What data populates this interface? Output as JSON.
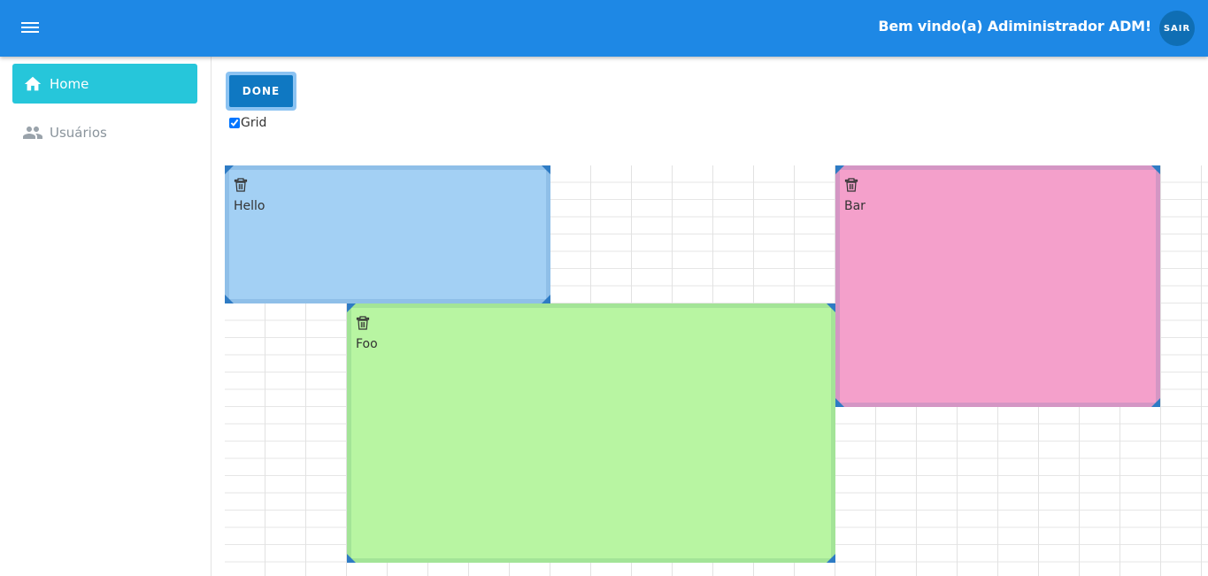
{
  "header": {
    "welcome_text": "Bem vindo(a) Adiministrador ADM!",
    "logout_label": "SAIR",
    "menu_icon": "hamburger-menu-icon",
    "background_color": "#1e88e5"
  },
  "sidebar": {
    "items": [
      {
        "label": "Home",
        "icon": "home-icon",
        "active": true
      },
      {
        "label": "Usuários",
        "icon": "people-icon",
        "active": false
      }
    ],
    "active_color": "#26c6da"
  },
  "toolbar": {
    "done_label": "DONE",
    "grid_label": "Grid",
    "grid_checked": true
  },
  "widgets": [
    {
      "label": "Hello",
      "color": "#a3d0f4",
      "icon": "trash-icon"
    },
    {
      "label": "Foo",
      "color": "#b8f5a2",
      "icon": "trash-icon"
    },
    {
      "label": "Bar",
      "color": "#f4a0cb",
      "icon": "trash-icon"
    }
  ]
}
